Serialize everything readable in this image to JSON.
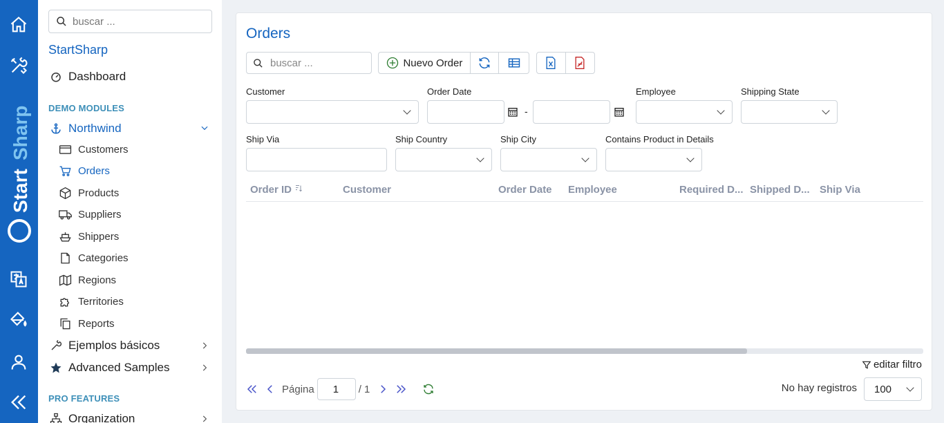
{
  "colors": {
    "accent": "#1565c0",
    "section": "#3d8fb8",
    "excel": "#1565c0",
    "pdf": "#c62828",
    "refresh": "#2e7d32"
  },
  "rail": {
    "brand": "StartSharp",
    "icons": [
      "home-icon",
      "tools-icon",
      "translate-icon",
      "paint-bucket-icon",
      "user-icon",
      "collapse-icon"
    ]
  },
  "sidebar": {
    "search_placeholder": "buscar ...",
    "title": "StartSharp",
    "dashboard": "Dashboard",
    "section_demo": "DEMO MODULES",
    "northwind": "Northwind",
    "items": [
      {
        "label": "Customers",
        "icon": "card-icon"
      },
      {
        "label": "Orders",
        "icon": "cart-icon",
        "active": true
      },
      {
        "label": "Products",
        "icon": "box-icon"
      },
      {
        "label": "Suppliers",
        "icon": "truck-icon"
      },
      {
        "label": "Shippers",
        "icon": "ship-icon"
      },
      {
        "label": "Categories",
        "icon": "page-icon"
      },
      {
        "label": "Regions",
        "icon": "map-icon"
      },
      {
        "label": "Territories",
        "icon": "puzzle-icon"
      },
      {
        "label": "Reports",
        "icon": "copy-icon"
      }
    ],
    "basic_examples": "Ejemplos básicos",
    "advanced": "Advanced Samples",
    "section_pro": "PRO FEATURES",
    "organization": "Organization"
  },
  "main": {
    "title": "Orders",
    "search_placeholder": "buscar ...",
    "new_button": "Nuevo Order",
    "filters": {
      "customer": "Customer",
      "order_date": "Order Date",
      "date_sep": "-",
      "employee": "Employee",
      "shipping_state": "Shipping State",
      "ship_via": "Ship Via",
      "ship_country": "Ship Country",
      "ship_city": "Ship City",
      "contains_product": "Contains Product in Details"
    },
    "columns": [
      "Order ID",
      "Customer",
      "Order Date",
      "Employee",
      "Required D...",
      "Shipped D...",
      "Ship Via"
    ],
    "scroll_fraction": 0.74,
    "edit_filter": "editar filtro",
    "pager": {
      "page_label": "Página",
      "page": "1",
      "of": "/ 1",
      "no_records": "No hay registros",
      "page_size": "100"
    }
  }
}
